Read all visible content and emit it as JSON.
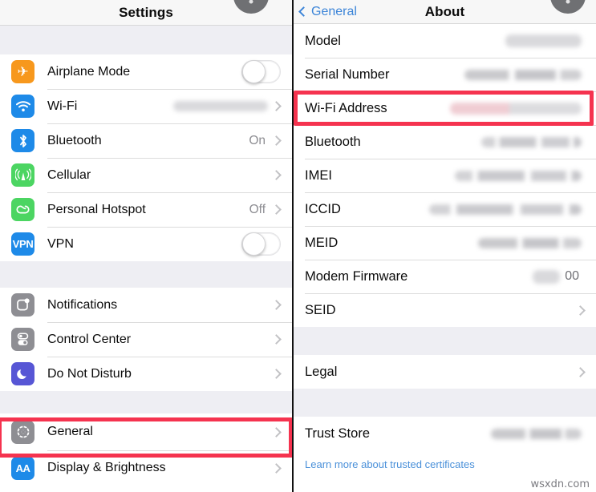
{
  "left_panel": {
    "nav": {
      "title": "Settings"
    },
    "sections": [
      {
        "rows": [
          {
            "label": "Airplane Mode",
            "icon": "airplane-icon",
            "icon_color": "#F7981D",
            "accessory": "toggle",
            "toggle_state": "off",
            "value": ""
          },
          {
            "label": "Wi-Fi",
            "icon": "wifi-icon",
            "icon_color": "#1E8AE8",
            "accessory": "chevron",
            "value": "",
            "redacted": true
          },
          {
            "label": "Bluetooth",
            "icon": "bluetooth-icon",
            "icon_color": "#1E8AE8",
            "accessory": "chevron",
            "value": "On"
          },
          {
            "label": "Cellular",
            "icon": "cellular-icon",
            "icon_color": "#4CD562",
            "accessory": "chevron",
            "value": ""
          },
          {
            "label": "Personal Hotspot",
            "icon": "hotspot-icon",
            "icon_color": "#4CD562",
            "accessory": "chevron",
            "value": "Off"
          },
          {
            "label": "VPN",
            "icon": "vpn-icon",
            "icon_color": "#1E8AE8",
            "accessory": "toggle",
            "toggle_state": "off",
            "value": ""
          }
        ]
      },
      {
        "rows": [
          {
            "label": "Notifications",
            "icon": "notifications-icon",
            "icon_color": "#8E8E93",
            "accessory": "chevron",
            "value": ""
          },
          {
            "label": "Control Center",
            "icon": "control-center-icon",
            "icon_color": "#8E8E93",
            "accessory": "chevron",
            "value": ""
          },
          {
            "label": "Do Not Disturb",
            "icon": "moon-icon",
            "icon_color": "#5756D5",
            "accessory": "chevron",
            "value": ""
          }
        ]
      },
      {
        "rows": [
          {
            "label": "General",
            "icon": "gear-icon",
            "icon_color": "#8E8E93",
            "accessory": "chevron",
            "value": "",
            "highlighted": true
          },
          {
            "label": "Display & Brightness",
            "icon": "display-brightness-icon",
            "icon_color": "#1E8AE8",
            "accessory": "chevron",
            "value": ""
          }
        ]
      }
    ]
  },
  "right_panel": {
    "nav": {
      "back_label": "General",
      "title": "About"
    },
    "sections": [
      {
        "rows": [
          {
            "label": "Model",
            "value": "",
            "redacted": true,
            "redact_width": 95,
            "accessory": "none"
          },
          {
            "label": "Serial Number",
            "value": "",
            "redacted": true,
            "redact_width": 146,
            "accessory": "none"
          },
          {
            "label": "Wi-Fi Address",
            "value": "",
            "redacted": true,
            "redact_width": 164,
            "accessory": "none",
            "highlighted": true
          },
          {
            "label": "Bluetooth",
            "value": "",
            "redacted": true,
            "redact_width": 125,
            "accessory": "none"
          },
          {
            "label": "IMEI",
            "value": "",
            "redacted": true,
            "redact_width": 158,
            "accessory": "none"
          },
          {
            "label": "ICCID",
            "value": "",
            "redacted": true,
            "redact_width": 190,
            "accessory": "none"
          },
          {
            "label": "MEID",
            "value": "",
            "redacted": true,
            "redact_width": 129,
            "accessory": "none"
          },
          {
            "label": "Modem Firmware",
            "value": "00",
            "redacted": true,
            "redact_width": 34,
            "accessory": "none"
          },
          {
            "label": "SEID",
            "value": "",
            "accessory": "chevron"
          }
        ]
      },
      {
        "rows": [
          {
            "label": "Legal",
            "value": "",
            "accessory": "chevron"
          }
        ]
      },
      {
        "rows": [
          {
            "label": "Trust Store",
            "value": "",
            "redacted": true,
            "redact_width": 113,
            "accessory": "none"
          }
        ]
      }
    ],
    "footer_link": "Learn more about trusted certificates"
  },
  "watermark": "wsxdn.com",
  "colors": {
    "highlight_red": "#F5334F",
    "link_blue": "#4A90D9",
    "nav_back_blue": "#3B84D8",
    "group_gap": "#EEEEF3"
  }
}
